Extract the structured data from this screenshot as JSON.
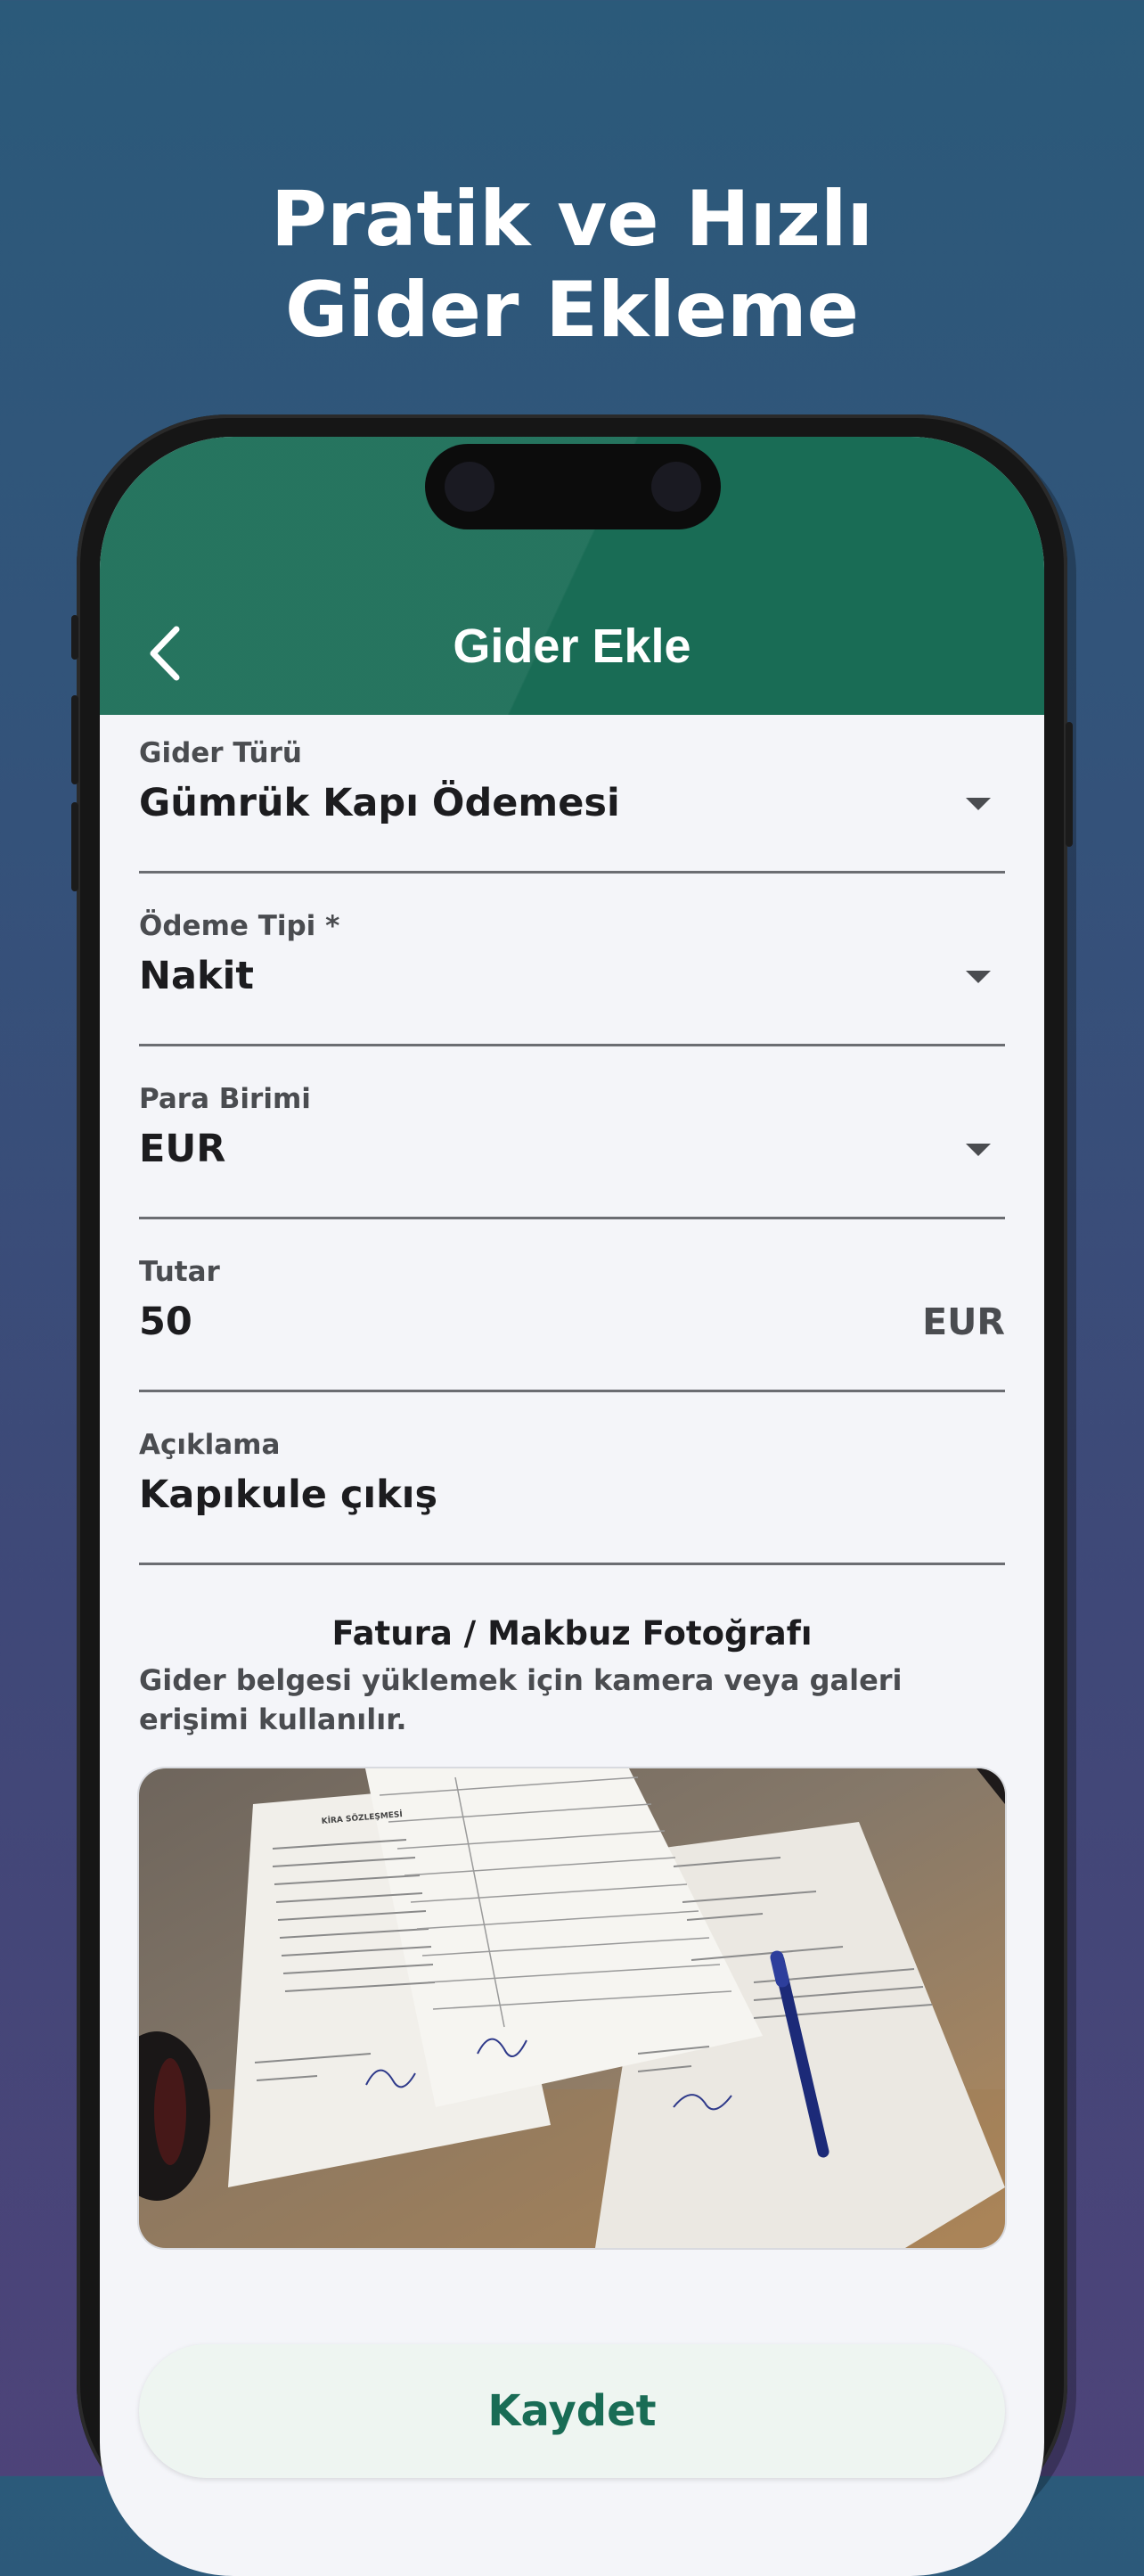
{
  "headline": {
    "line1": "Pratik ve Hızlı",
    "line2": "Gider Ekleme"
  },
  "colors": {
    "appbar": "#196c55",
    "accent": "#196c55",
    "screen_bg": "#f4f5f9"
  },
  "appbar": {
    "title": "Gider Ekle",
    "back_icon": "chevron-left-icon"
  },
  "form": {
    "expense_type": {
      "label": "Gider Türü",
      "value": "Gümrük Kapı Ödemesi"
    },
    "payment_type": {
      "label": "Ödeme Tipi *",
      "value": "Nakit"
    },
    "currency": {
      "label": "Para Birimi",
      "value": "EUR"
    },
    "amount": {
      "label": "Tutar",
      "value": "50",
      "suffix": "EUR"
    },
    "description": {
      "label": "Açıklama",
      "value": "Kapıkule çıkış"
    }
  },
  "photo_section": {
    "title": "Fatura / Makbuz Fotoğrafı",
    "description": "Gider belgesi yüklemek için kamera veya galeri erişimi kullanılır.",
    "document_title": "KİRA SÖZLEŞMESİ"
  },
  "save_button": {
    "label": "Kaydet"
  }
}
